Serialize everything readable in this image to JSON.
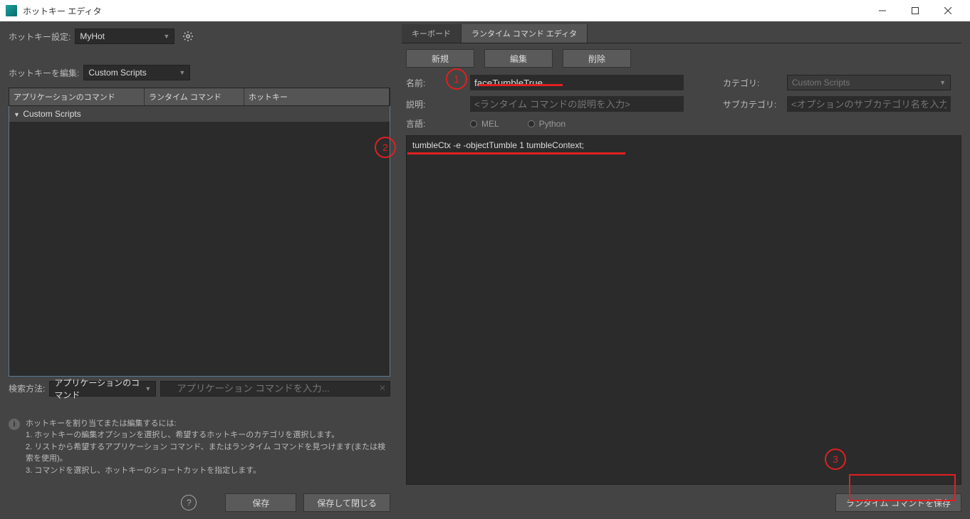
{
  "window": {
    "title": "ホットキー エディタ"
  },
  "left": {
    "hotkeySetLabel": "ホットキー設定:",
    "hotkeySetValue": "MyHot",
    "editHotkeyLabel": "ホットキーを編集:",
    "editHotkeyValue": "Custom Scripts",
    "col1": "アプリケーションのコマンド",
    "col2": "ランタイム コマンド",
    "col3": "ホットキー",
    "treeItem": "Custom Scripts",
    "searchMethodLabel": "検索方法:",
    "searchMethodValue": "アプリケーションのコマンド",
    "searchPlaceholder": "アプリケーション コマンドを入力...",
    "helpTitle": "ホットキーを割り当てまたは編集するには:",
    "help1": "1. ホットキーの編集オプションを選択し、希望するホットキーのカテゴリを選択します。",
    "help2": "2. リストから希望するアプリケーション コマンド、またはランタイム コマンドを見つけます(または検索を使用)。",
    "help3": "3. コマンドを選択し、ホットキーのショートカットを指定します。",
    "saveBtn": "保存",
    "saveCloseBtn": "保存して閉じる"
  },
  "right": {
    "tab1": "キーボード",
    "tab2": "ランタイム コマンド エディタ",
    "newBtn": "新規",
    "editBtn": "編集",
    "deleteBtn": "削除",
    "nameLabel": "名前:",
    "nameValue": "faceTumbleTrue",
    "categoryLabel": "カテゴリ:",
    "categoryValue": "Custom Scripts",
    "descLabel": "説明:",
    "descPlaceholder": "<ランタイム コマンドの説明を入力>",
    "subcatLabel": "サブカテゴリ:",
    "subcatPlaceholder": "<オプションのサブカテゴリ名を入力>",
    "langLabel": "言語:",
    "langMel": "MEL",
    "langPython": "Python",
    "code": "tumbleCtx -e -objectTumble 1 tumbleContext;",
    "saveRuntimeBtn": "ランタイム コマンドを保存"
  },
  "annotations": {
    "n1": "1",
    "n2": "2",
    "n3": "3"
  }
}
